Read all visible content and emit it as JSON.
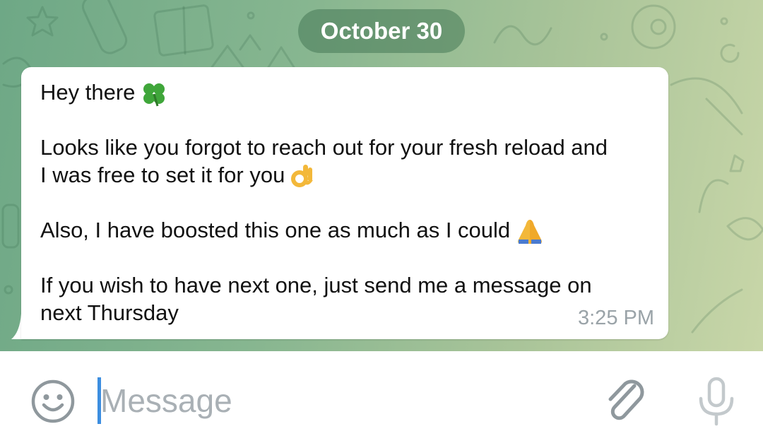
{
  "chat": {
    "date_label": "October 30",
    "message": {
      "line1": "Hey there",
      "line1_emoji": "four-leaf-clover-icon",
      "line2": "Looks like you forgot to reach out for your fresh reload and",
      "line3": "I was free to set it for you",
      "line3_emoji": "ok-hand-icon",
      "line4": "Also, I have boosted this one as much as I could",
      "line4_emoji": "folded-hands-icon",
      "line5": "If you wish to have next one, just send me a message on",
      "line6": "next Thursday",
      "time": "3:25 PM"
    }
  },
  "input_bar": {
    "placeholder": "Message",
    "emoji_button_icon": "smiley-icon",
    "attach_button_icon": "paperclip-icon",
    "mic_button_icon": "microphone-icon"
  },
  "colors": {
    "accent": "#3d8ee0",
    "icon_gray": "#9aa3a8",
    "bubble": "#ffffff",
    "wallpaper_start": "#6ea886",
    "wallpaper_end": "#c8d6a8"
  }
}
